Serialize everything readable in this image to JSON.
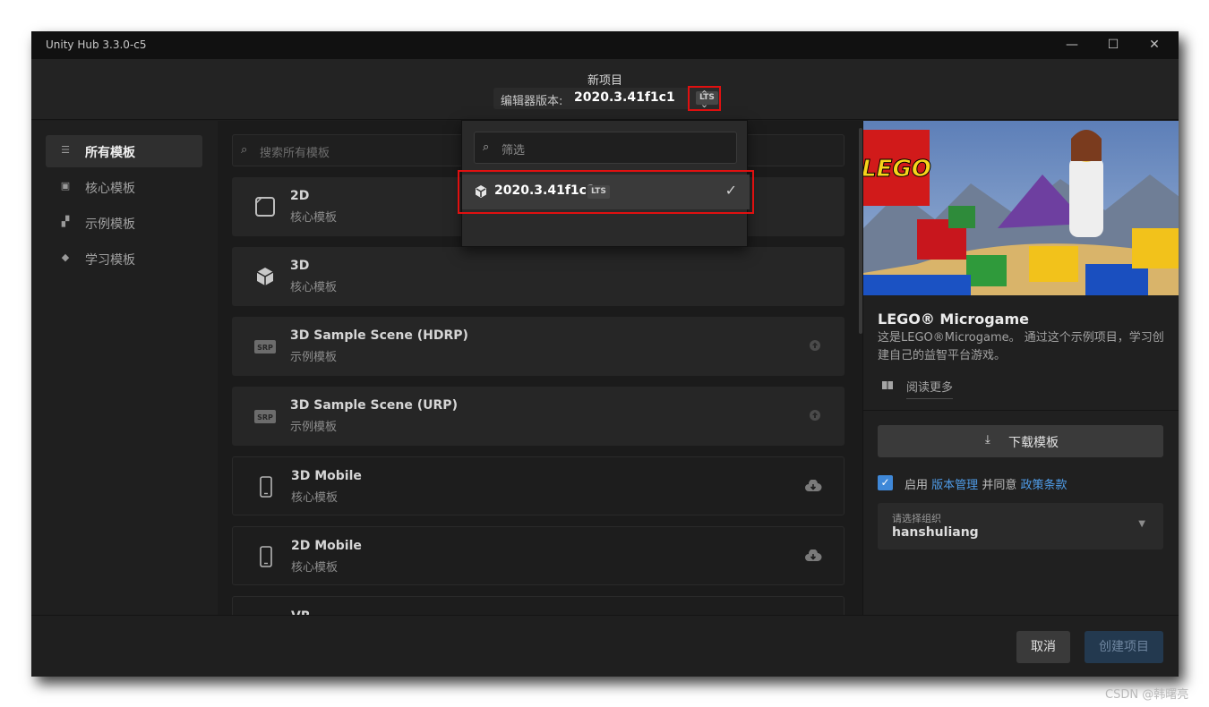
{
  "window": {
    "title": "Unity Hub 3.3.0-c5",
    "minimize_icon": "minimize-icon",
    "maximize_icon": "maximize-icon",
    "close_icon": "close-icon"
  },
  "header": {
    "project_title": "新项目",
    "editor_version_label": "编辑器版本:",
    "editor_version_value": "2020.3.41f1c1",
    "lts_badge": "LTS",
    "toggle_icon": "chevron-up-down-icon"
  },
  "dropdown": {
    "filter_placeholder": "筛选",
    "options": [
      {
        "version": "2020.3.41f1c1",
        "badge": "LTS",
        "selected": true
      }
    ]
  },
  "sidebar": {
    "items": [
      {
        "label": "所有模板",
        "icon": "list-icon",
        "active": true
      },
      {
        "label": "核心模板",
        "icon": "core-square-icon",
        "active": false
      },
      {
        "label": "示例模板",
        "icon": "sample-blocks-icon",
        "active": false
      },
      {
        "label": "学习模板",
        "icon": "graduation-cap-icon",
        "active": false
      }
    ]
  },
  "search": {
    "placeholder": "搜索所有模板"
  },
  "templates": [
    {
      "name": "2D",
      "tag": "核心模板",
      "icon": "2d-square-icon",
      "status": ""
    },
    {
      "name": "3D",
      "tag": "核心模板",
      "icon": "3d-cube-icon",
      "status": ""
    },
    {
      "name": "3D Sample Scene (HDRP)",
      "tag": "示例模板",
      "icon": "srp-icon",
      "icon_text": "SRP",
      "status": "upload-icon"
    },
    {
      "name": "3D Sample Scene (URP)",
      "tag": "示例模板",
      "icon": "srp-icon",
      "icon_text": "SRP",
      "status": "upload-icon"
    },
    {
      "name": "3D Mobile",
      "tag": "核心模板",
      "icon": "mobile-phone-icon",
      "status": "cloud-download-icon"
    },
    {
      "name": "2D Mobile",
      "tag": "核心模板",
      "icon": "mobile-phone-icon",
      "status": "cloud-download-icon"
    },
    {
      "name": "VR",
      "tag": "",
      "icon": "",
      "status": ""
    }
  ],
  "detail": {
    "title": "LEGO® Microgame",
    "description": "这是LEGO®Microgame。 通过这个示例项目，学习创建自己的益智平台游戏。",
    "read_more": "阅读更多",
    "download_button": "下载模板",
    "vc_prefix": "启用",
    "vc_link": "版本管理",
    "vc_middle": "并同意",
    "policy_link": "政策条款",
    "vc_checked": true,
    "org_label": "请选择组织",
    "org_value": "hanshuliang"
  },
  "footer": {
    "cancel": "取消",
    "create": "创建项目"
  },
  "watermark": "CSDN @韩曙亮",
  "colors": {
    "accent_blue": "#3f88d8",
    "highlight_red": "#e01010",
    "create_disabled": "#23394f"
  }
}
